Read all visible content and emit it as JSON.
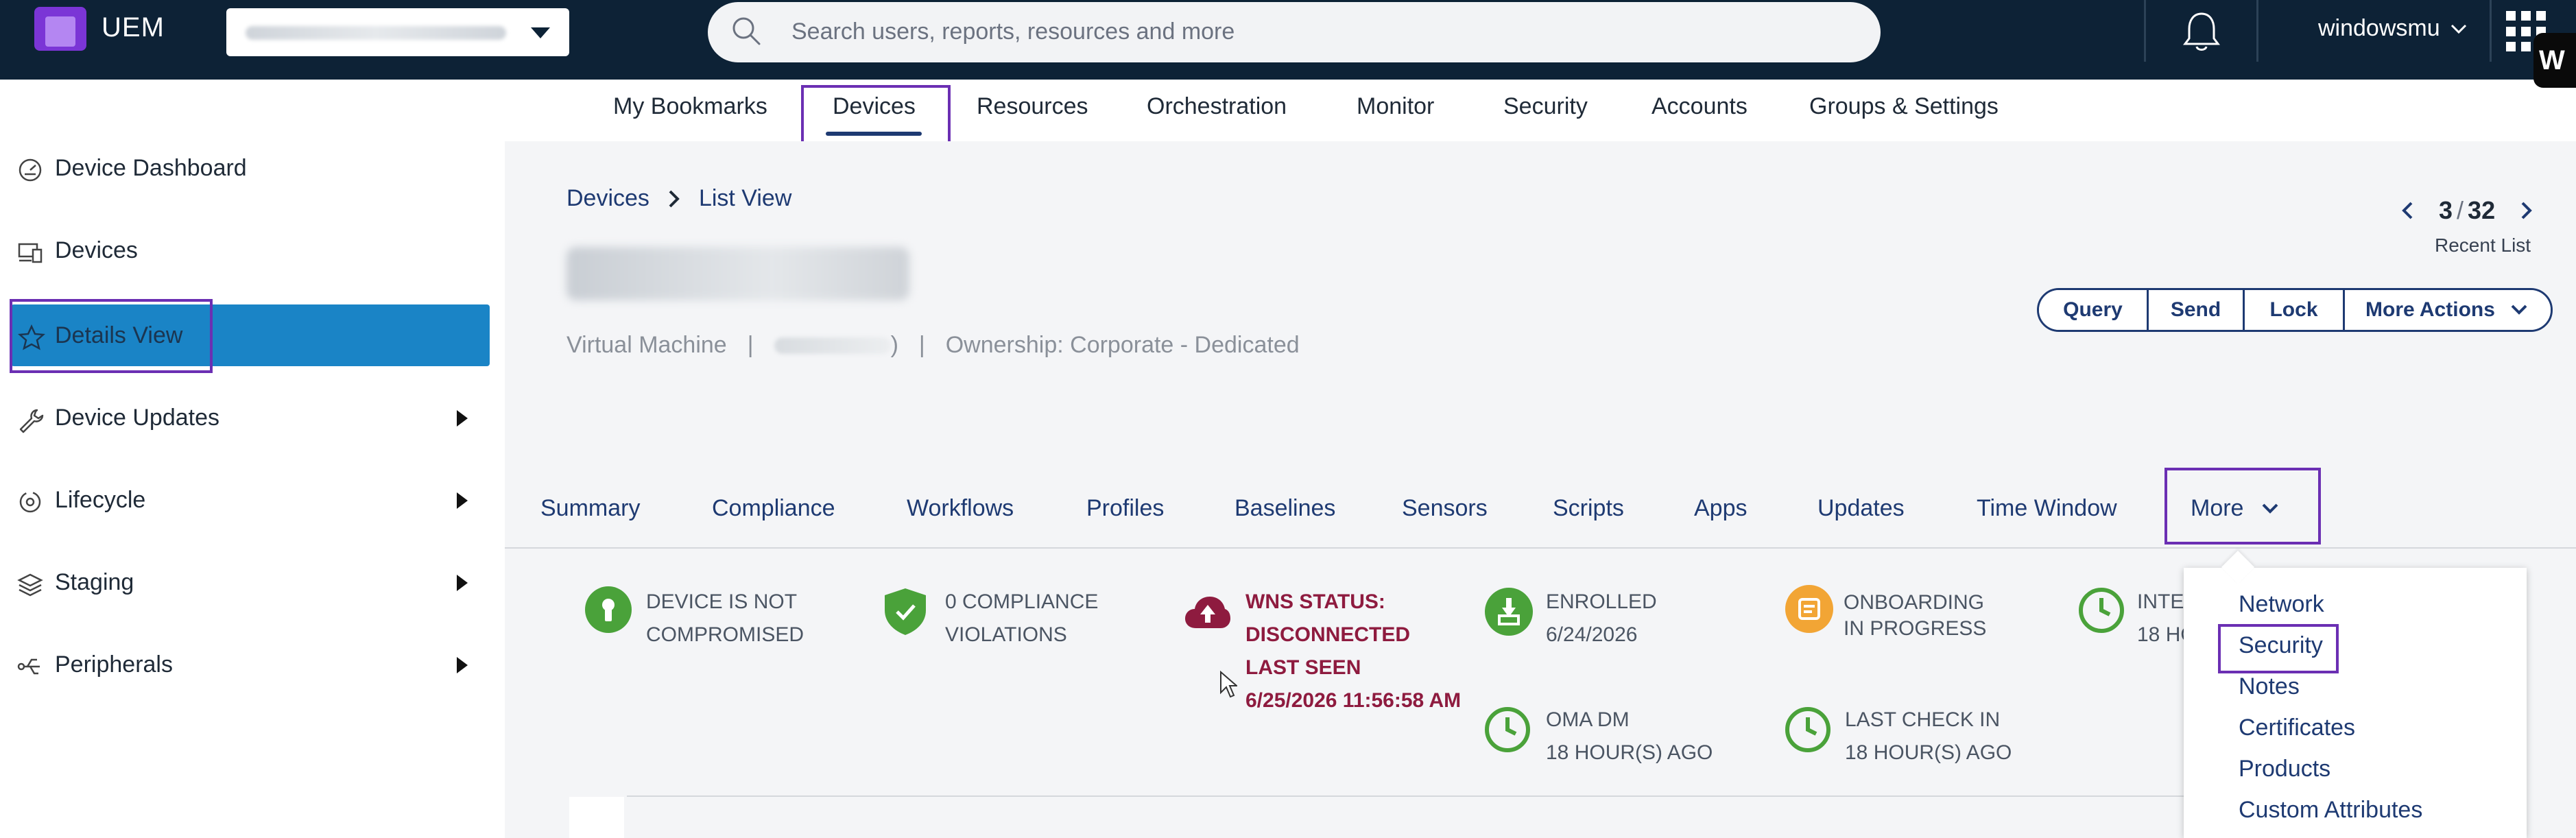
{
  "topbar": {
    "brand": "UEM",
    "search_placeholder": "Search users, reports, resources and more",
    "username": "windowsmu",
    "badge": "W"
  },
  "main_nav": [
    {
      "label": "My Bookmarks"
    },
    {
      "label": "Devices"
    },
    {
      "label": "Resources"
    },
    {
      "label": "Orchestration"
    },
    {
      "label": "Monitor"
    },
    {
      "label": "Security"
    },
    {
      "label": "Accounts"
    },
    {
      "label": "Groups & Settings"
    }
  ],
  "sidebar": {
    "items": [
      {
        "label": "Device Dashboard",
        "icon": "dashboard-icon"
      },
      {
        "label": "Devices",
        "icon": "devices-icon"
      },
      {
        "label": "Details View",
        "icon": "star-icon"
      },
      {
        "label": "Device Updates",
        "icon": "wrench-icon"
      },
      {
        "label": "Lifecycle",
        "icon": "lifecycle-icon"
      },
      {
        "label": "Staging",
        "icon": "layers-icon"
      },
      {
        "label": "Peripherals",
        "icon": "peripherals-icon"
      }
    ]
  },
  "breadcrumb": {
    "root": "Devices",
    "current": "List View"
  },
  "device": {
    "type": "Virtual Machine",
    "sep1": "|",
    "paren": ")",
    "sep2": "|",
    "ownership": "Ownership: Corporate - Dedicated"
  },
  "pager": {
    "current": "3",
    "sep": "/",
    "total": "32",
    "label": "Recent List"
  },
  "actions": {
    "query": "Query",
    "send": "Send",
    "lock": "Lock",
    "more": "More Actions"
  },
  "tabs": [
    {
      "label": "Summary"
    },
    {
      "label": "Compliance"
    },
    {
      "label": "Workflows"
    },
    {
      "label": "Profiles"
    },
    {
      "label": "Baselines"
    },
    {
      "label": "Sensors"
    },
    {
      "label": "Scripts"
    },
    {
      "label": "Apps"
    },
    {
      "label": "Updates"
    },
    {
      "label": "Time Window"
    },
    {
      "label": "More"
    }
  ],
  "status": {
    "compromised": {
      "line1": "DEVICE IS NOT",
      "line2": "COMPROMISED"
    },
    "compliance": {
      "line1": "0 COMPLIANCE",
      "line2": "VIOLATIONS"
    },
    "wns": {
      "line1": "WNS STATUS:",
      "line2": "DISCONNECTED",
      "line3": "LAST SEEN",
      "line4": "6/25/2026 11:56:58 AM"
    },
    "enrolled": {
      "line1": "ENROLLED",
      "line2": "6/24/2026"
    },
    "onboarding": {
      "line1": "ONBOARDING",
      "line2": "IN PROGRESS"
    },
    "interval": {
      "line1": "INTE",
      "line2": "18 HO"
    },
    "omadm": {
      "line1": "OMA DM",
      "line2": "18 HOUR(S) AGO"
    },
    "lastcheckin": {
      "line1": "LAST CHECK IN",
      "line2": "18 HOUR(S) AGO"
    }
  },
  "more_menu": [
    {
      "label": "Network"
    },
    {
      "label": "Security"
    },
    {
      "label": "Notes"
    },
    {
      "label": "Certificates"
    },
    {
      "label": "Products"
    },
    {
      "label": "Custom Attributes"
    }
  ],
  "colors": {
    "topbar": "#0d2236",
    "accent_purple": "#6b2fb3",
    "nav_blue": "#1e3a72",
    "active_sidebar": "#1a84c6",
    "status_green": "#4aa23a",
    "status_orange": "#f2a535",
    "alert_red": "#8e1b3f"
  }
}
